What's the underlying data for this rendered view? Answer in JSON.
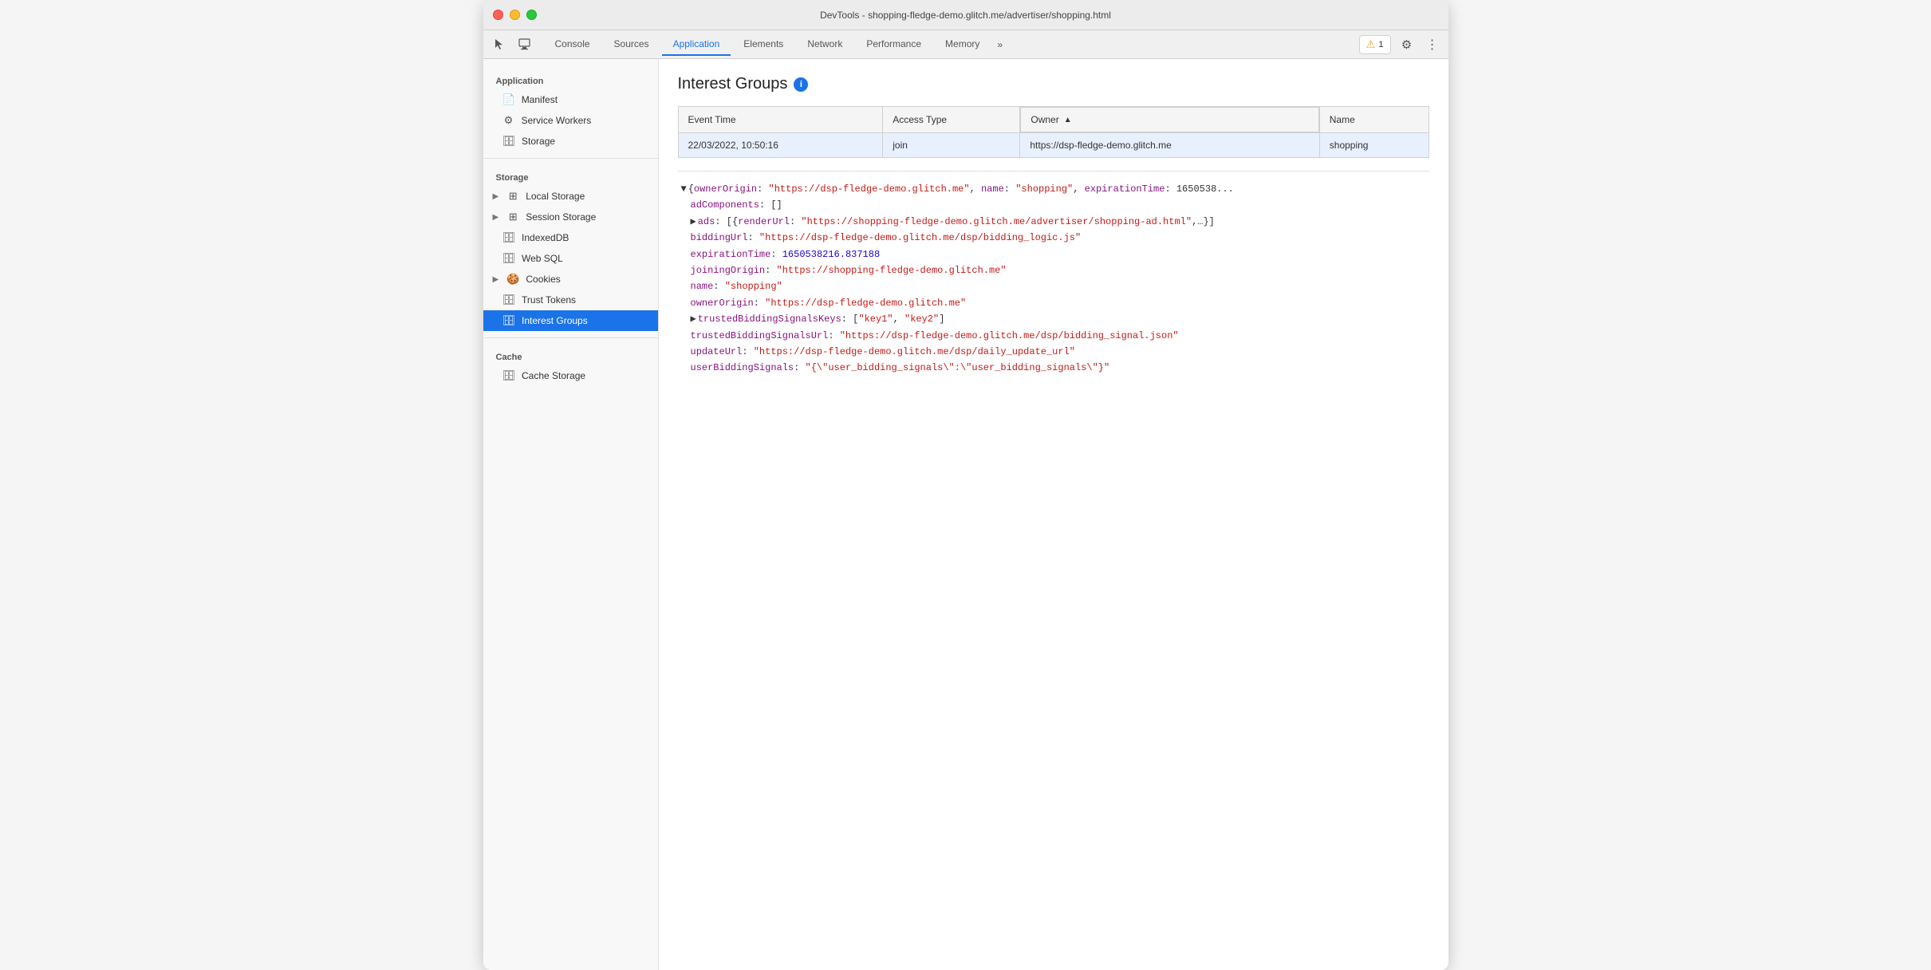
{
  "titlebar": {
    "title": "DevTools - shopping-fledge-demo.glitch.me/advertiser/shopping.html"
  },
  "tabs": {
    "items": [
      {
        "id": "console",
        "label": "Console",
        "active": false
      },
      {
        "id": "sources",
        "label": "Sources",
        "active": false
      },
      {
        "id": "application",
        "label": "Application",
        "active": true
      },
      {
        "id": "elements",
        "label": "Elements",
        "active": false
      },
      {
        "id": "network",
        "label": "Network",
        "active": false
      },
      {
        "id": "performance",
        "label": "Performance",
        "active": false
      },
      {
        "id": "memory",
        "label": "Memory",
        "active": false
      }
    ],
    "more_label": "»",
    "warning_count": "1",
    "gear_icon": "⚙",
    "dots_icon": "⋮"
  },
  "sidebar": {
    "section_application": "Application",
    "manifest_label": "Manifest",
    "service_workers_label": "Service Workers",
    "storage_section_label": "Storage",
    "storage_label": "Storage",
    "local_storage_label": "Local Storage",
    "session_storage_label": "Session Storage",
    "indexed_db_label": "IndexedDB",
    "web_sql_label": "Web SQL",
    "cookies_label": "Cookies",
    "trust_tokens_label": "Trust Tokens",
    "interest_groups_label": "Interest Groups",
    "cache_section_label": "Cache",
    "cache_storage_label": "Cache Storage"
  },
  "content": {
    "page_title": "Interest Groups",
    "info_icon_label": "i",
    "table": {
      "columns": [
        {
          "id": "event_time",
          "label": "Event Time"
        },
        {
          "id": "access_type",
          "label": "Access Type"
        },
        {
          "id": "owner",
          "label": "Owner",
          "sorted": true
        },
        {
          "id": "name",
          "label": "Name"
        }
      ],
      "rows": [
        {
          "event_time": "22/03/2022, 10:50:16",
          "access_type": "join",
          "owner": "https://dsp-fledge-demo.glitch.me",
          "name": "shopping",
          "selected": true
        }
      ]
    },
    "detail": {
      "line1_text": "▼ {ownerOrigin: \"https://dsp-fledge-demo.glitch.me\", name: \"shopping\", expirationTime: 1650538...",
      "ad_components": "adComponents: []",
      "ads_line": "▶ ads: [{renderUrl: \"https://shopping-fledge-demo.glitch.me/advertiser/shopping-ad.html\",...}]",
      "bidding_url_key": "biddingUrl",
      "bidding_url_val": "\"https://dsp-fledge-demo.glitch.me/dsp/bidding_logic.js\"",
      "expiration_key": "expirationTime",
      "expiration_val": "1650538216.837188",
      "joining_origin_key": "joiningOrigin",
      "joining_origin_val": "\"https://shopping-fledge-demo.glitch.me\"",
      "name_key": "name",
      "name_val": "\"shopping\"",
      "owner_origin_key": "ownerOrigin",
      "owner_origin_val": "\"https://dsp-fledge-demo.glitch.me\"",
      "trusted_keys_line": "▶ trustedBiddingSignalsKeys: [\"key1\", \"key2\"]",
      "trusted_url_key": "trustedBiddingSignalsUrl",
      "trusted_url_val": "\"https://dsp-fledge-demo.glitch.me/dsp/bidding_signal.json\"",
      "update_url_key": "updateUrl",
      "update_url_val": "\"https://dsp-fledge-demo.glitch.me/dsp/daily_update_url\"",
      "user_signals_key": "userBiddingSignals",
      "user_signals_val": "\"{\\\"user_bidding_signals\\\":\\\"user_bidding_signals\\\"}\""
    }
  }
}
